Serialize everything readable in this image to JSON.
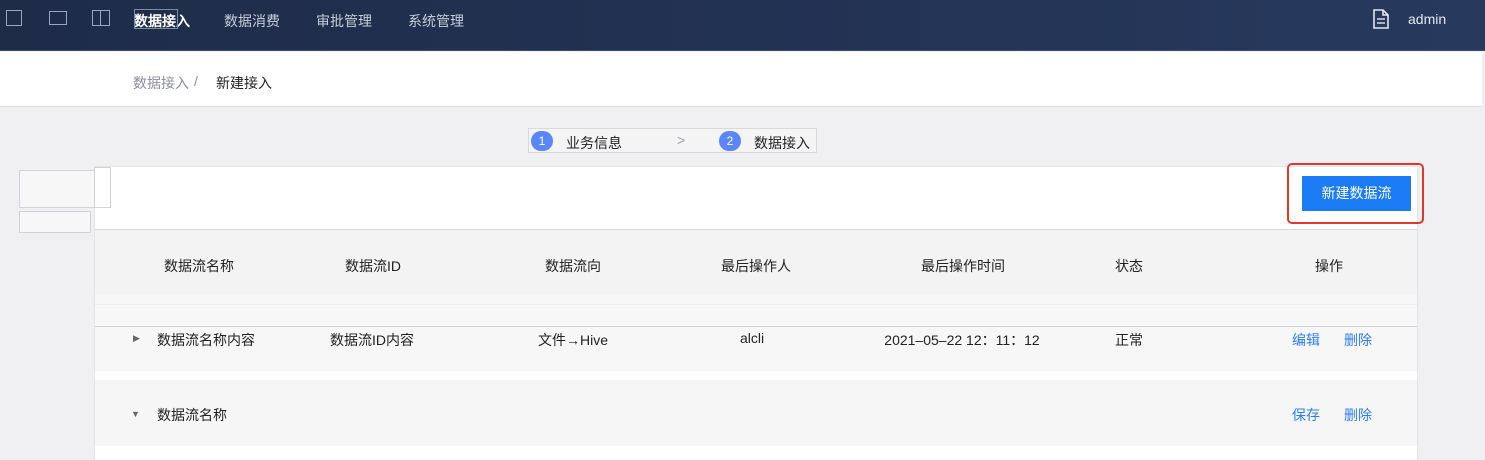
{
  "nav": {
    "items": [
      {
        "label": "数据接入",
        "active": true
      },
      {
        "label": "数据消费",
        "active": false
      },
      {
        "label": "审批管理",
        "active": false
      },
      {
        "label": "系统管理",
        "active": false
      }
    ],
    "user": "admin",
    "icons": [
      "square-icon",
      "square-icon",
      "split-panel-icon",
      "document-icon"
    ]
  },
  "breadcrumb": {
    "parent": "数据接入",
    "separator": "/",
    "current": "新建接入"
  },
  "steps": [
    {
      "number": "1",
      "label": "业务信息"
    },
    {
      "number": "2",
      "label": "数据接入"
    }
  ],
  "step_separator": ">",
  "toolbar": {
    "new_button": "新建数据流"
  },
  "table": {
    "headers": [
      "数据流名称",
      "数据流ID",
      "数据流向",
      "最后操作人",
      "最后操作时间",
      "状态",
      "操作"
    ],
    "rows": [
      {
        "expanded": false,
        "name": "数据流名称内容",
        "id": "数据流ID内容",
        "direction": "文件→Hive",
        "operator": "alcli",
        "time": "2021–05–22 12：11：12",
        "status": "正常",
        "actions": [
          "编辑",
          "删除"
        ]
      },
      {
        "expanded": true,
        "name": "数据流名称",
        "actions": [
          "保存",
          "删除"
        ]
      }
    ]
  },
  "colors": {
    "accent": "#1b7cf5",
    "highlight": "#e03a2f",
    "step": "#5b86f5",
    "link": "#2d7ff4"
  }
}
